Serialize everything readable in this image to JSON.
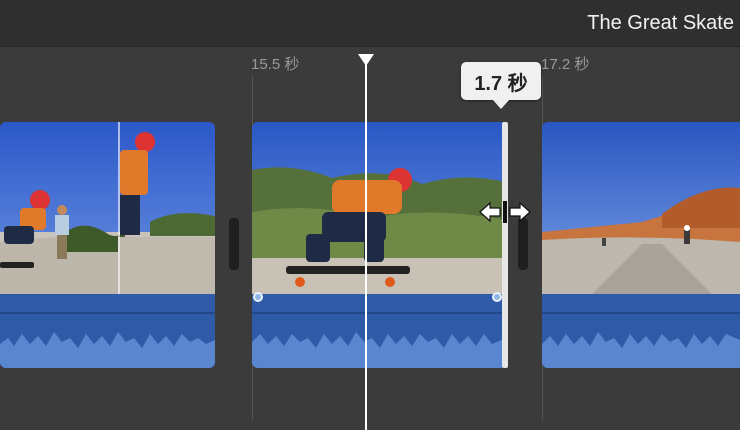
{
  "project": {
    "title": "The Great Skate"
  },
  "ruler": {
    "label_left": "15.5 秒",
    "label_right": "17.2 秒"
  },
  "trim_tooltip": {
    "duration": "1.7 秒"
  },
  "icons": {
    "playhead": "playhead-triangle",
    "cursor": "resize-left-right-cursor"
  },
  "colors": {
    "timeline_bg": "#3b3b3b",
    "audio_waveform": "#2e5aa8",
    "waveform_fill": "#5a86cf",
    "playhead": "#ffffff",
    "tooltip_bg": "#f0f0f0"
  },
  "clips": [
    {
      "id": "clip-1",
      "desc": "skater-near-bushes"
    },
    {
      "id": "clip-2",
      "desc": "skater-crouching-on-board"
    },
    {
      "id": "clip-3",
      "desc": "skaters-on-road-by-cliffs"
    }
  ]
}
